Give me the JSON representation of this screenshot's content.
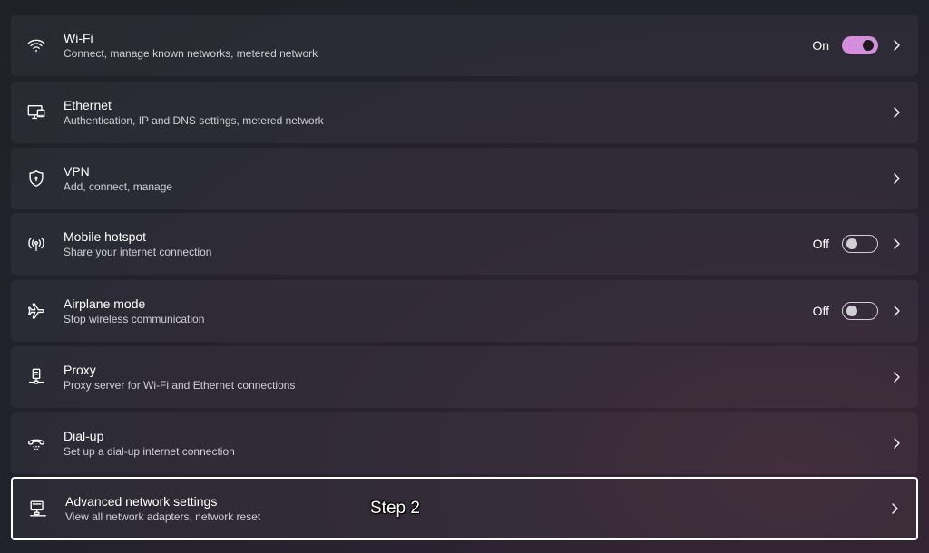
{
  "items": [
    {
      "id": "wifi",
      "title": "Wi-Fi",
      "subtitle": "Connect, manage known networks, metered network",
      "state": "On",
      "toggle": "on"
    },
    {
      "id": "ethernet",
      "title": "Ethernet",
      "subtitle": "Authentication, IP and DNS settings, metered network"
    },
    {
      "id": "vpn",
      "title": "VPN",
      "subtitle": "Add, connect, manage"
    },
    {
      "id": "hotspot",
      "title": "Mobile hotspot",
      "subtitle": "Share your internet connection",
      "state": "Off",
      "toggle": "off"
    },
    {
      "id": "airplane",
      "title": "Airplane mode",
      "subtitle": "Stop wireless communication",
      "state": "Off",
      "toggle": "off"
    },
    {
      "id": "proxy",
      "title": "Proxy",
      "subtitle": "Proxy server for Wi-Fi and Ethernet connections"
    },
    {
      "id": "dialup",
      "title": "Dial-up",
      "subtitle": "Set up a dial-up internet connection"
    },
    {
      "id": "advanced",
      "title": "Advanced network settings",
      "subtitle": "View all network adapters, network reset"
    }
  ],
  "annotation": {
    "label": "Step 2"
  },
  "icons": [
    "wifi-icon",
    "ethernet-icon",
    "vpn-shield-icon",
    "hotspot-icon",
    "airplane-icon",
    "proxy-icon",
    "dialup-icon",
    "network-adapter-icon",
    "chevron-right-icon"
  ],
  "colors": {
    "toggle_on": "#d48fdc",
    "highlight_border": "#ffffff"
  }
}
